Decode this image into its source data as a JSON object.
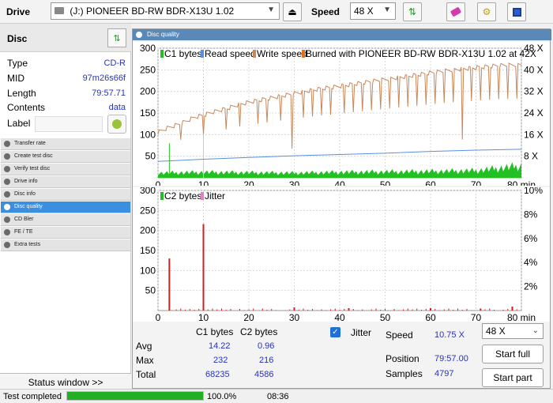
{
  "toolbar": {
    "drive_label": "Drive",
    "drive_value": "(J:)  PIONEER BD-RW   BDR-X13U 1.02",
    "speed_label": "Speed",
    "speed_value": "48 X"
  },
  "disc": {
    "title": "Disc",
    "rows": [
      {
        "label": "Type",
        "value": "CD-R"
      },
      {
        "label": "MID",
        "value": "97m26s66f"
      },
      {
        "label": "Length",
        "value": "79:57.71"
      },
      {
        "label": "Contents",
        "value": "data"
      },
      {
        "label": "Label",
        "value": ""
      }
    ]
  },
  "menu": [
    "Transfer rate",
    "Create test disc",
    "Verify test disc",
    "Drive info",
    "Disc info",
    "Disc quality",
    "CD Bler",
    "FE / TE",
    "Extra tests"
  ],
  "status_window_label": "Status window >>",
  "panel_title": "Disc quality",
  "chart_data": [
    {
      "type": "line",
      "title": "C1 bytes  Read speed  Write speed  Burned with PIONEER BD-RW   BDR-X13U 1.02 at 42X",
      "legend": [
        "C1 bytes",
        "Read speed",
        "Write speed",
        "Burned with PIONEER BD-RW   BDR-X13U 1.02 at 42X"
      ],
      "x_ticks": [
        0,
        10,
        20,
        30,
        40,
        50,
        60,
        70,
        80
      ],
      "x_unit": "min",
      "ylim": [
        0,
        300
      ],
      "y_ticks": [
        50,
        100,
        150,
        200,
        250,
        300
      ],
      "y2_ticks": [
        "8 X",
        "16 X",
        "24 X",
        "32 X",
        "40 X",
        "48 X"
      ],
      "series": [
        {
          "name": "Read speed",
          "color": "#c8875a",
          "x": [
            0,
            2,
            4,
            6,
            8,
            10,
            12,
            15,
            18,
            20,
            25,
            30,
            35,
            40,
            45,
            50,
            55,
            60,
            65,
            70,
            75,
            80
          ],
          "values": [
            105,
            115,
            122,
            130,
            140,
            145,
            152,
            160,
            170,
            175,
            185,
            195,
            205,
            212,
            220,
            228,
            235,
            243,
            250,
            255,
            260,
            262
          ]
        },
        {
          "name": "C1 bytes",
          "color": "#22c022",
          "x": [
            0,
            10,
            20,
            30,
            40,
            50,
            60,
            70,
            80
          ],
          "values": [
            12,
            14,
            13,
            12,
            14,
            15,
            16,
            18,
            30
          ]
        },
        {
          "name": "Jitter",
          "color": "#5a8fe0",
          "x": [
            0,
            10,
            20,
            30,
            40,
            50,
            60,
            70,
            80
          ],
          "values": [
            38,
            43,
            47,
            51,
            54,
            57,
            61,
            64,
            66
          ]
        }
      ],
      "dips_x": [
        5,
        10,
        15,
        18,
        22,
        24,
        27,
        29.5,
        32,
        34,
        36,
        38,
        41,
        43,
        45,
        47,
        49,
        51,
        53,
        55,
        57,
        59,
        61,
        63,
        65,
        67,
        69,
        71,
        73,
        75,
        77,
        79
      ],
      "spikes_x": [
        2.5,
        10
      ]
    },
    {
      "type": "bar",
      "title": "C2 bytes  Jitter",
      "legend": [
        "C2 bytes",
        "Jitter"
      ],
      "x_ticks": [
        0,
        10,
        20,
        30,
        40,
        50,
        60,
        70,
        80
      ],
      "x_unit": "min",
      "ylim": [
        0,
        300
      ],
      "y_ticks": [
        50,
        100,
        150,
        200,
        250,
        300
      ],
      "y2_ticks": [
        "2%",
        "4%",
        "6%",
        "8%",
        "10%"
      ],
      "spikes": [
        {
          "x": 2.5,
          "value": 130,
          "color": "#cc2222"
        },
        {
          "x": 10,
          "value": 216,
          "color": "#cc2222"
        },
        {
          "x": 30,
          "value": 8,
          "color": "#cc2222"
        },
        {
          "x": 42,
          "value": 6,
          "color": "#cc2222"
        },
        {
          "x": 60,
          "value": 6,
          "color": "#cc2222"
        },
        {
          "x": 71,
          "value": 5,
          "color": "#cc2222"
        },
        {
          "x": 78,
          "value": 10,
          "color": "#cc2222"
        }
      ]
    }
  ],
  "stats": {
    "col_c1": "C1 bytes",
    "col_c2": "C2 bytes",
    "rows": [
      {
        "label": "Avg",
        "c1": "14.22",
        "c2": "0.96"
      },
      {
        "label": "Max",
        "c1": "232",
        "c2": "216"
      },
      {
        "label": "Total",
        "c1": "68235",
        "c2": "4586"
      }
    ],
    "jitter_label": "Jitter",
    "speed_label": "Speed",
    "speed_value": "10.75 X",
    "position_label": "Position",
    "position_value": "79:57.00",
    "samples_label": "Samples",
    "samples_value": "4797",
    "speed_select": "48 X",
    "start_full": "Start full",
    "start_part": "Start part"
  },
  "statusbar": {
    "text": "Test completed",
    "progress": 1.0,
    "progress_label": "100.0%",
    "time": "08:36"
  }
}
